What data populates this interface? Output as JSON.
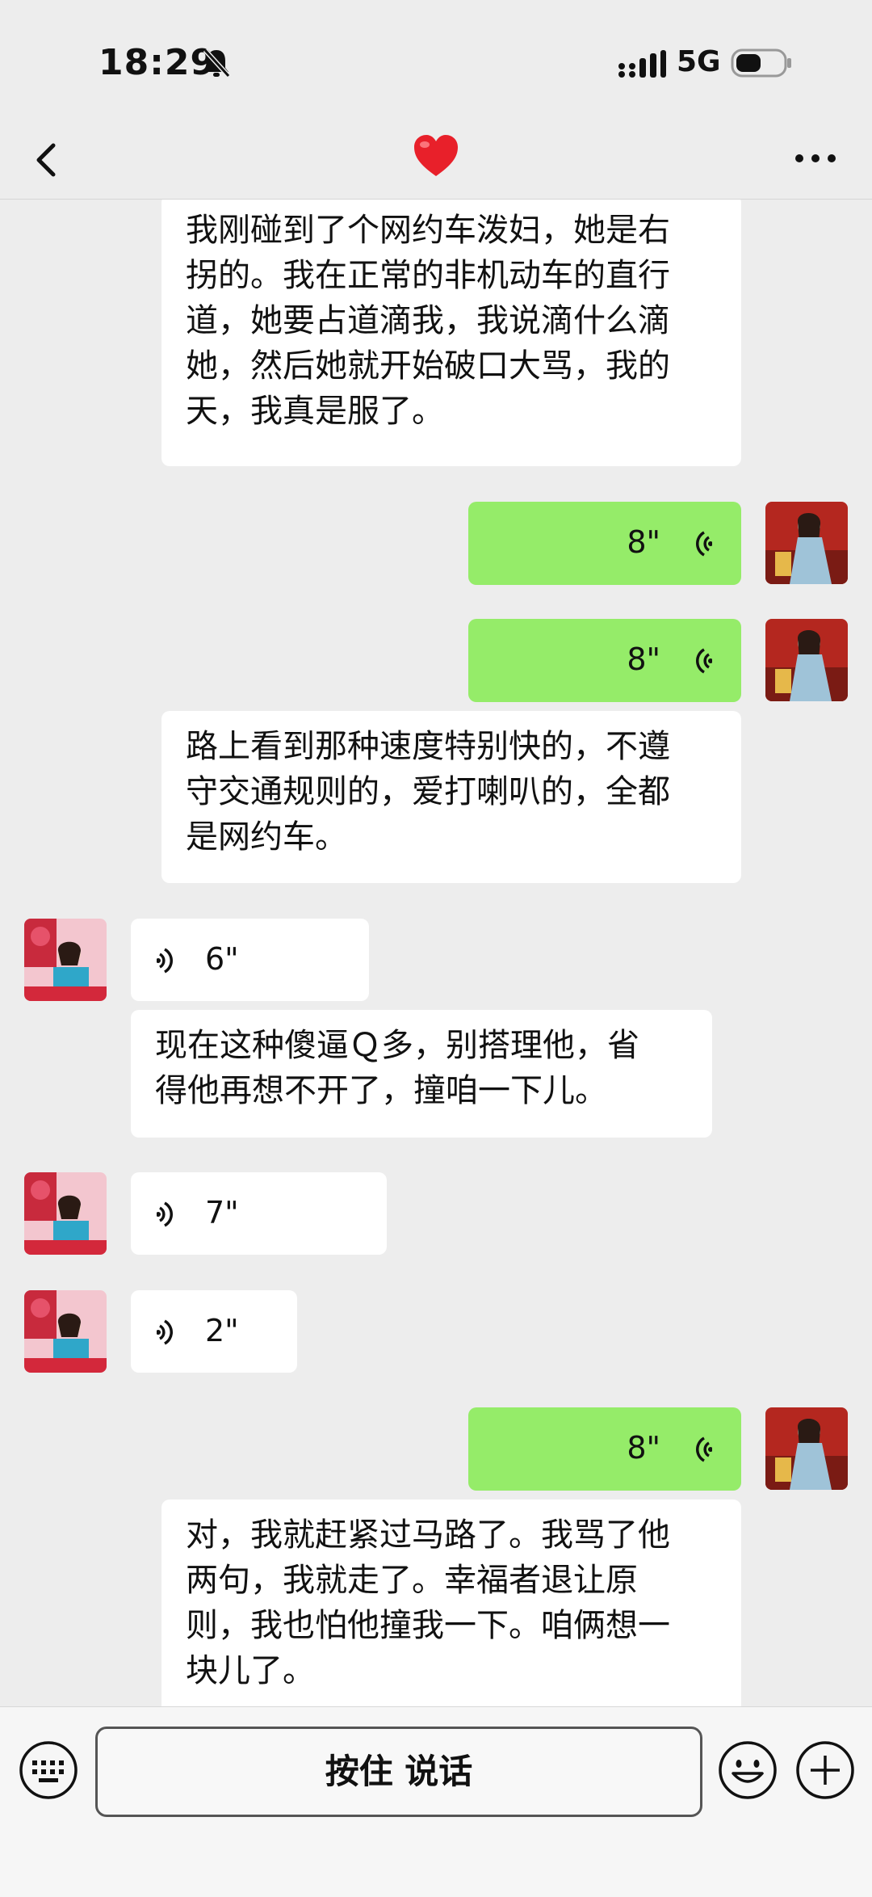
{
  "status": {
    "time": "18:29",
    "network": "5G"
  },
  "nav": {
    "title_icon": "heart-icon",
    "back_icon": "chevron-left-icon",
    "more_icon": "more-icon"
  },
  "messages": [
    {
      "id": "m1",
      "side": "left",
      "type": "text",
      "text_lines": [
        "我刚碰到了个网约车泼妇，她是右",
        "拐的。我在正常的非机动车的直行",
        "道，她要占道滴我，我说滴什么滴",
        "她，然后她就开始破口大骂，我的",
        "天，我真是服了。"
      ]
    },
    {
      "id": "m2",
      "side": "right",
      "type": "voice",
      "duration": "8\""
    },
    {
      "id": "m3",
      "side": "right",
      "type": "voice",
      "duration": "8\""
    },
    {
      "id": "m4",
      "side": "left",
      "type": "text",
      "text_lines": [
        "路上看到那种速度特别快的，不遵",
        "守交通规则的，爱打喇叭的，全都",
        "是网约车。"
      ]
    },
    {
      "id": "m5",
      "side": "left",
      "type": "voice",
      "duration": "6\""
    },
    {
      "id": "m6",
      "side": "left",
      "type": "text",
      "text_lines": [
        "现在这种傻逼Ｑ多，别搭理他，省",
        "得他再想不开了，撞咱一下儿。"
      ]
    },
    {
      "id": "m7",
      "side": "left",
      "type": "voice",
      "duration": "7\""
    },
    {
      "id": "m8",
      "side": "left",
      "type": "voice",
      "duration": "2\""
    },
    {
      "id": "m9",
      "side": "right",
      "type": "voice",
      "duration": "8\""
    },
    {
      "id": "m10",
      "side": "left",
      "type": "text",
      "text_lines": [
        "对，我就赶紧过马路了。我骂了他",
        "两句，我就走了。幸福者退让原",
        "则，我也怕他撞我一下。咱俩想一",
        "块儿了。"
      ]
    }
  ],
  "input": {
    "hold_to_talk": "按住 说话"
  },
  "colors": {
    "background": "#ededed",
    "sent_bubble": "#95ec69",
    "received_bubble": "#ffffff"
  }
}
